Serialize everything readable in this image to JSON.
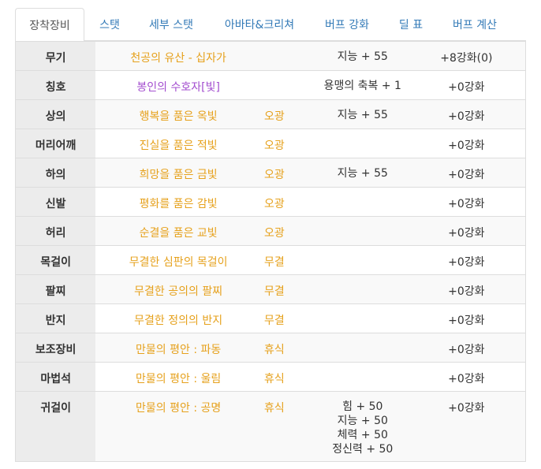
{
  "tabs": [
    {
      "label": "장착장비",
      "active": true
    },
    {
      "label": "스탯",
      "active": false
    },
    {
      "label": "세부 스탯",
      "active": false
    },
    {
      "label": "아바타&크리쳐",
      "active": false
    },
    {
      "label": "버프 강화",
      "active": false
    },
    {
      "label": "딜 표",
      "active": false
    },
    {
      "label": "버프 계산",
      "active": false
    }
  ],
  "colors": {
    "tab_link": "#337ab7",
    "item_orange": "#e6a11c",
    "item_purple": "#a34ecf",
    "slot_bg": "#ececec",
    "border": "#dddddd"
  },
  "equipment": [
    {
      "slot": "무기",
      "item": "천공의 유산 - 십자가",
      "grade": "",
      "options": [
        "지능 + 55"
      ],
      "enhance": "+8강화(0)"
    },
    {
      "slot": "칭호",
      "item": "봉인의 수호자[빛]",
      "grade": "",
      "options": [
        "용맹의 축복 + 1"
      ],
      "enhance": "+0강화"
    },
    {
      "slot": "상의",
      "item": "행복을 품은 옥빛",
      "grade": "오광",
      "options": [
        "지능 + 55"
      ],
      "enhance": "+0강화"
    },
    {
      "slot": "머리어깨",
      "item": "진실을 품은 적빛",
      "grade": "오광",
      "options": [],
      "enhance": "+0강화"
    },
    {
      "slot": "하의",
      "item": "희망을 품은 금빛",
      "grade": "오광",
      "options": [
        "지능 + 55"
      ],
      "enhance": "+0강화"
    },
    {
      "slot": "신발",
      "item": "평화를 품은 감빛",
      "grade": "오광",
      "options": [],
      "enhance": "+0강화"
    },
    {
      "slot": "허리",
      "item": "순결을 품은 교빛",
      "grade": "오광",
      "options": [],
      "enhance": "+0강화"
    },
    {
      "slot": "목걸이",
      "item": "무결한 심판의 목걸이",
      "grade": "무결",
      "options": [],
      "enhance": "+0강화"
    },
    {
      "slot": "팔찌",
      "item": "무결한 공의의 팔찌",
      "grade": "무결",
      "options": [],
      "enhance": "+0강화"
    },
    {
      "slot": "반지",
      "item": "무결한 정의의 반지",
      "grade": "무결",
      "options": [],
      "enhance": "+0강화"
    },
    {
      "slot": "보조장비",
      "item": "만물의 평안 : 파동",
      "grade": "휴식",
      "options": [],
      "enhance": "+0강화"
    },
    {
      "slot": "마법석",
      "item": "만물의 평안 : 울림",
      "grade": "휴식",
      "options": [],
      "enhance": "+0강화"
    },
    {
      "slot": "귀걸이",
      "item": "만물의 평안 : 공명",
      "grade": "휴식",
      "options": [
        "힘 + 50",
        "지능 + 50",
        "체력 + 50",
        "정신력 + 50"
      ],
      "enhance": "+0강화"
    }
  ]
}
